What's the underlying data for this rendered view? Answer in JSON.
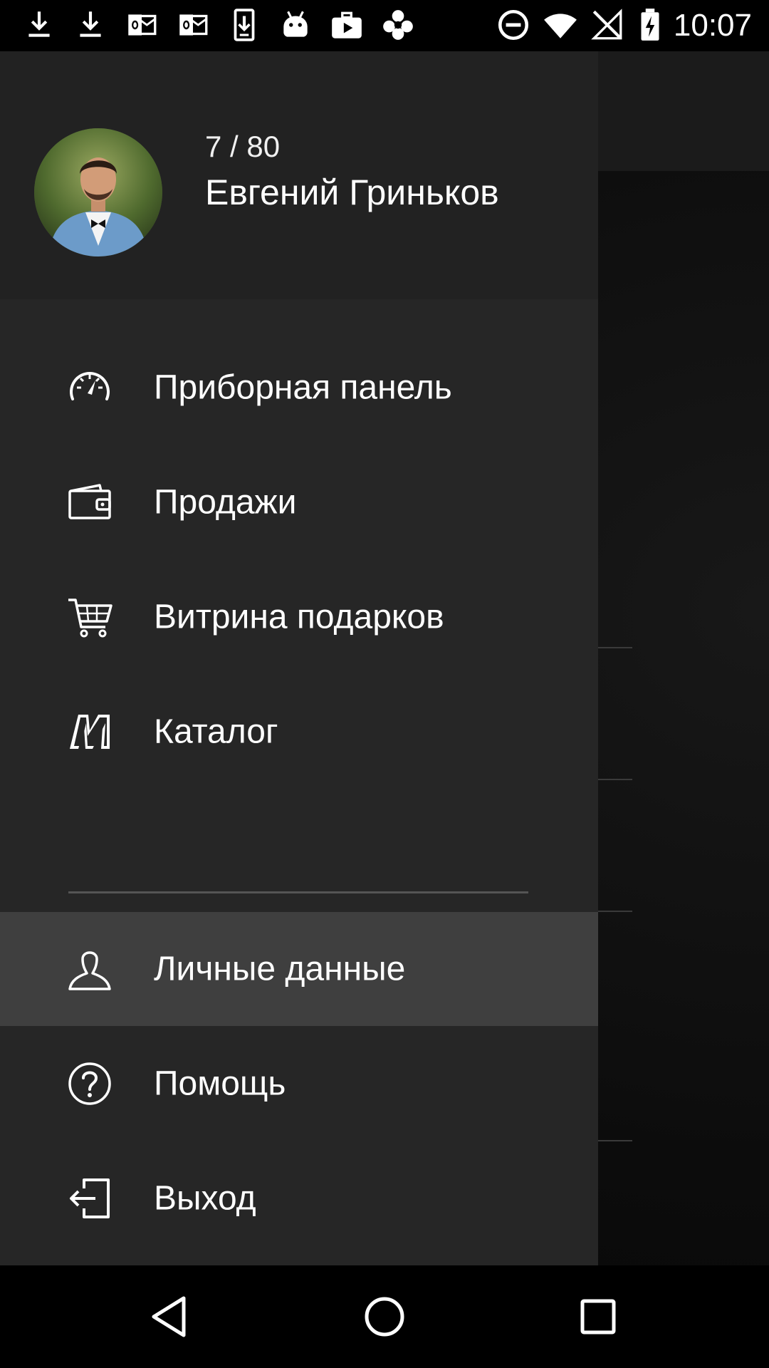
{
  "status_bar": {
    "time": "10:07",
    "icons": [
      "download-icon",
      "download-icon",
      "outlook-icon",
      "outlook-icon",
      "sim-download-icon",
      "android-icon",
      "video-briefcase-icon",
      "settings-flower-icon",
      "do-not-disturb-icon",
      "wifi-icon",
      "no-signal-icon",
      "battery-charging-icon"
    ]
  },
  "drawer": {
    "header": {
      "counter": "7 / 80",
      "name": "Евгений Гриньков"
    },
    "menu": [
      {
        "label": "Приборная панель",
        "icon": "speedometer-icon"
      },
      {
        "label": "Продажи",
        "icon": "wallet-icon"
      },
      {
        "label": "Витрина подарков",
        "icon": "cart-icon"
      },
      {
        "label": "Каталог",
        "icon": "catalog-m-icon"
      },
      {
        "label": "Личные данные",
        "icon": "person-icon",
        "active": true
      },
      {
        "label": "Помощь",
        "icon": "help-icon"
      },
      {
        "label": "Выход",
        "icon": "exit-icon"
      }
    ]
  },
  "nav_bar": {
    "buttons": [
      "back-icon",
      "home-icon",
      "recents-icon"
    ]
  }
}
